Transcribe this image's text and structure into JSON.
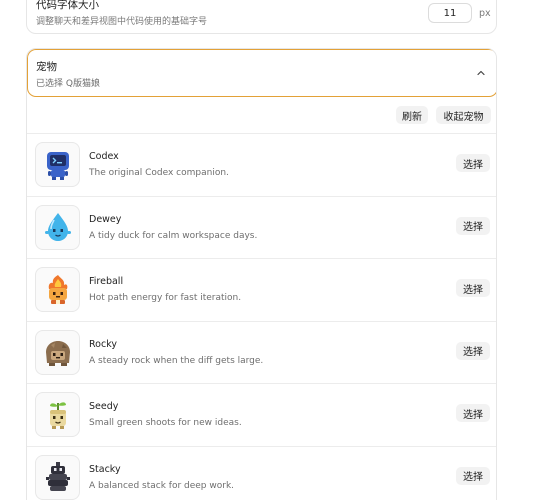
{
  "font_setting": {
    "title": "代码字体大小",
    "description": "调整聊天和差异视图中代码使用的基础字号",
    "value": "11",
    "unit": "px"
  },
  "pet_section": {
    "title": "宠物",
    "selected_text": "已选择 Q版猫娘",
    "refresh_label": "刷新",
    "collapse_label": "收起宠物",
    "select_label": "选择",
    "pets": [
      {
        "name": "Codex",
        "description": "The original Codex companion.",
        "icon": "codex-robot-icon"
      },
      {
        "name": "Dewey",
        "description": "A tidy duck for calm workspace days.",
        "icon": "dewey-droplet-icon"
      },
      {
        "name": "Fireball",
        "description": "Hot path energy for fast iteration.",
        "icon": "fireball-icon"
      },
      {
        "name": "Rocky",
        "description": "A steady rock when the diff gets large.",
        "icon": "rocky-rock-icon"
      },
      {
        "name": "Seedy",
        "description": "Small green shoots for new ideas.",
        "icon": "seedy-sprout-icon"
      },
      {
        "name": "Stacky",
        "description": "A balanced stack for deep work.",
        "icon": "stacky-stack-icon"
      }
    ]
  }
}
